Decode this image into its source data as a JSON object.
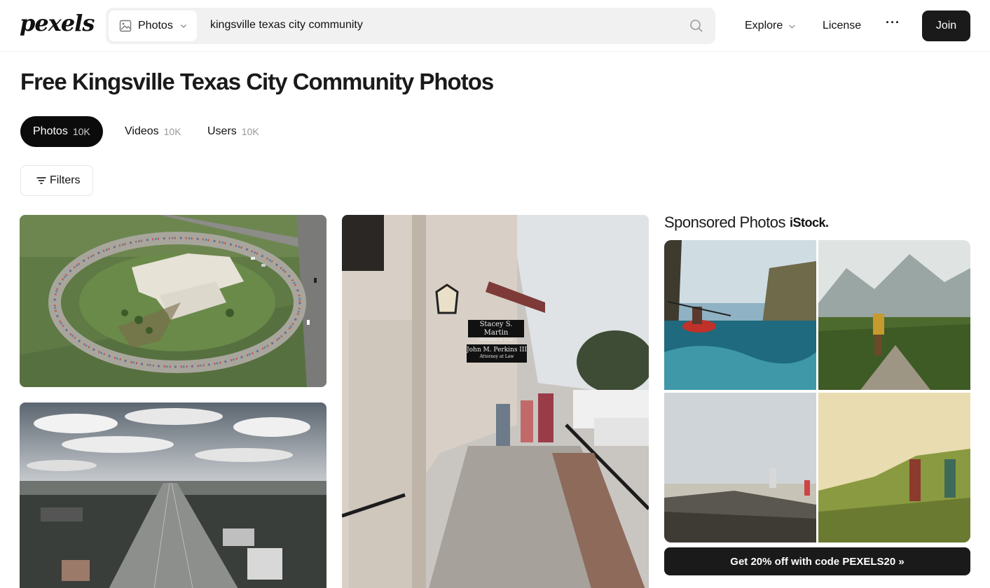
{
  "header": {
    "logo": "pexels",
    "search_type": "Photos",
    "search_query": "kingsville texas city community",
    "nav": {
      "explore": "Explore",
      "license": "License",
      "more": "···"
    },
    "join_label": "Join"
  },
  "page_title": "Free Kingsville Texas City Community Photos",
  "tabs": [
    {
      "label": "Photos",
      "count": "10K",
      "active": true
    },
    {
      "label": "Videos",
      "count": "10K",
      "active": false
    },
    {
      "label": "Users",
      "count": "10K",
      "active": false
    }
  ],
  "filters_label": "Filters",
  "photos": [
    {
      "description": "Aerial view of community center"
    },
    {
      "description": "Highway through city"
    },
    {
      "description": "Downtown storefront sidewalk"
    }
  ],
  "storefront_signs": {
    "sign1_line1": "Stacey S. Martin",
    "sign1_line2": "Attorney at Law",
    "sign2_line1": "John M. Perkins III",
    "sign2_line2": "Attorney at Law"
  },
  "sponsored": {
    "title": "Sponsored Photos",
    "brand": "iStock.",
    "promo": "Get 20% off with code PEXELS20 »"
  },
  "colors": {
    "accent": "#0b0b0b",
    "promo_bg": "#1a1a1a",
    "search_bg": "#f1f1f1"
  }
}
